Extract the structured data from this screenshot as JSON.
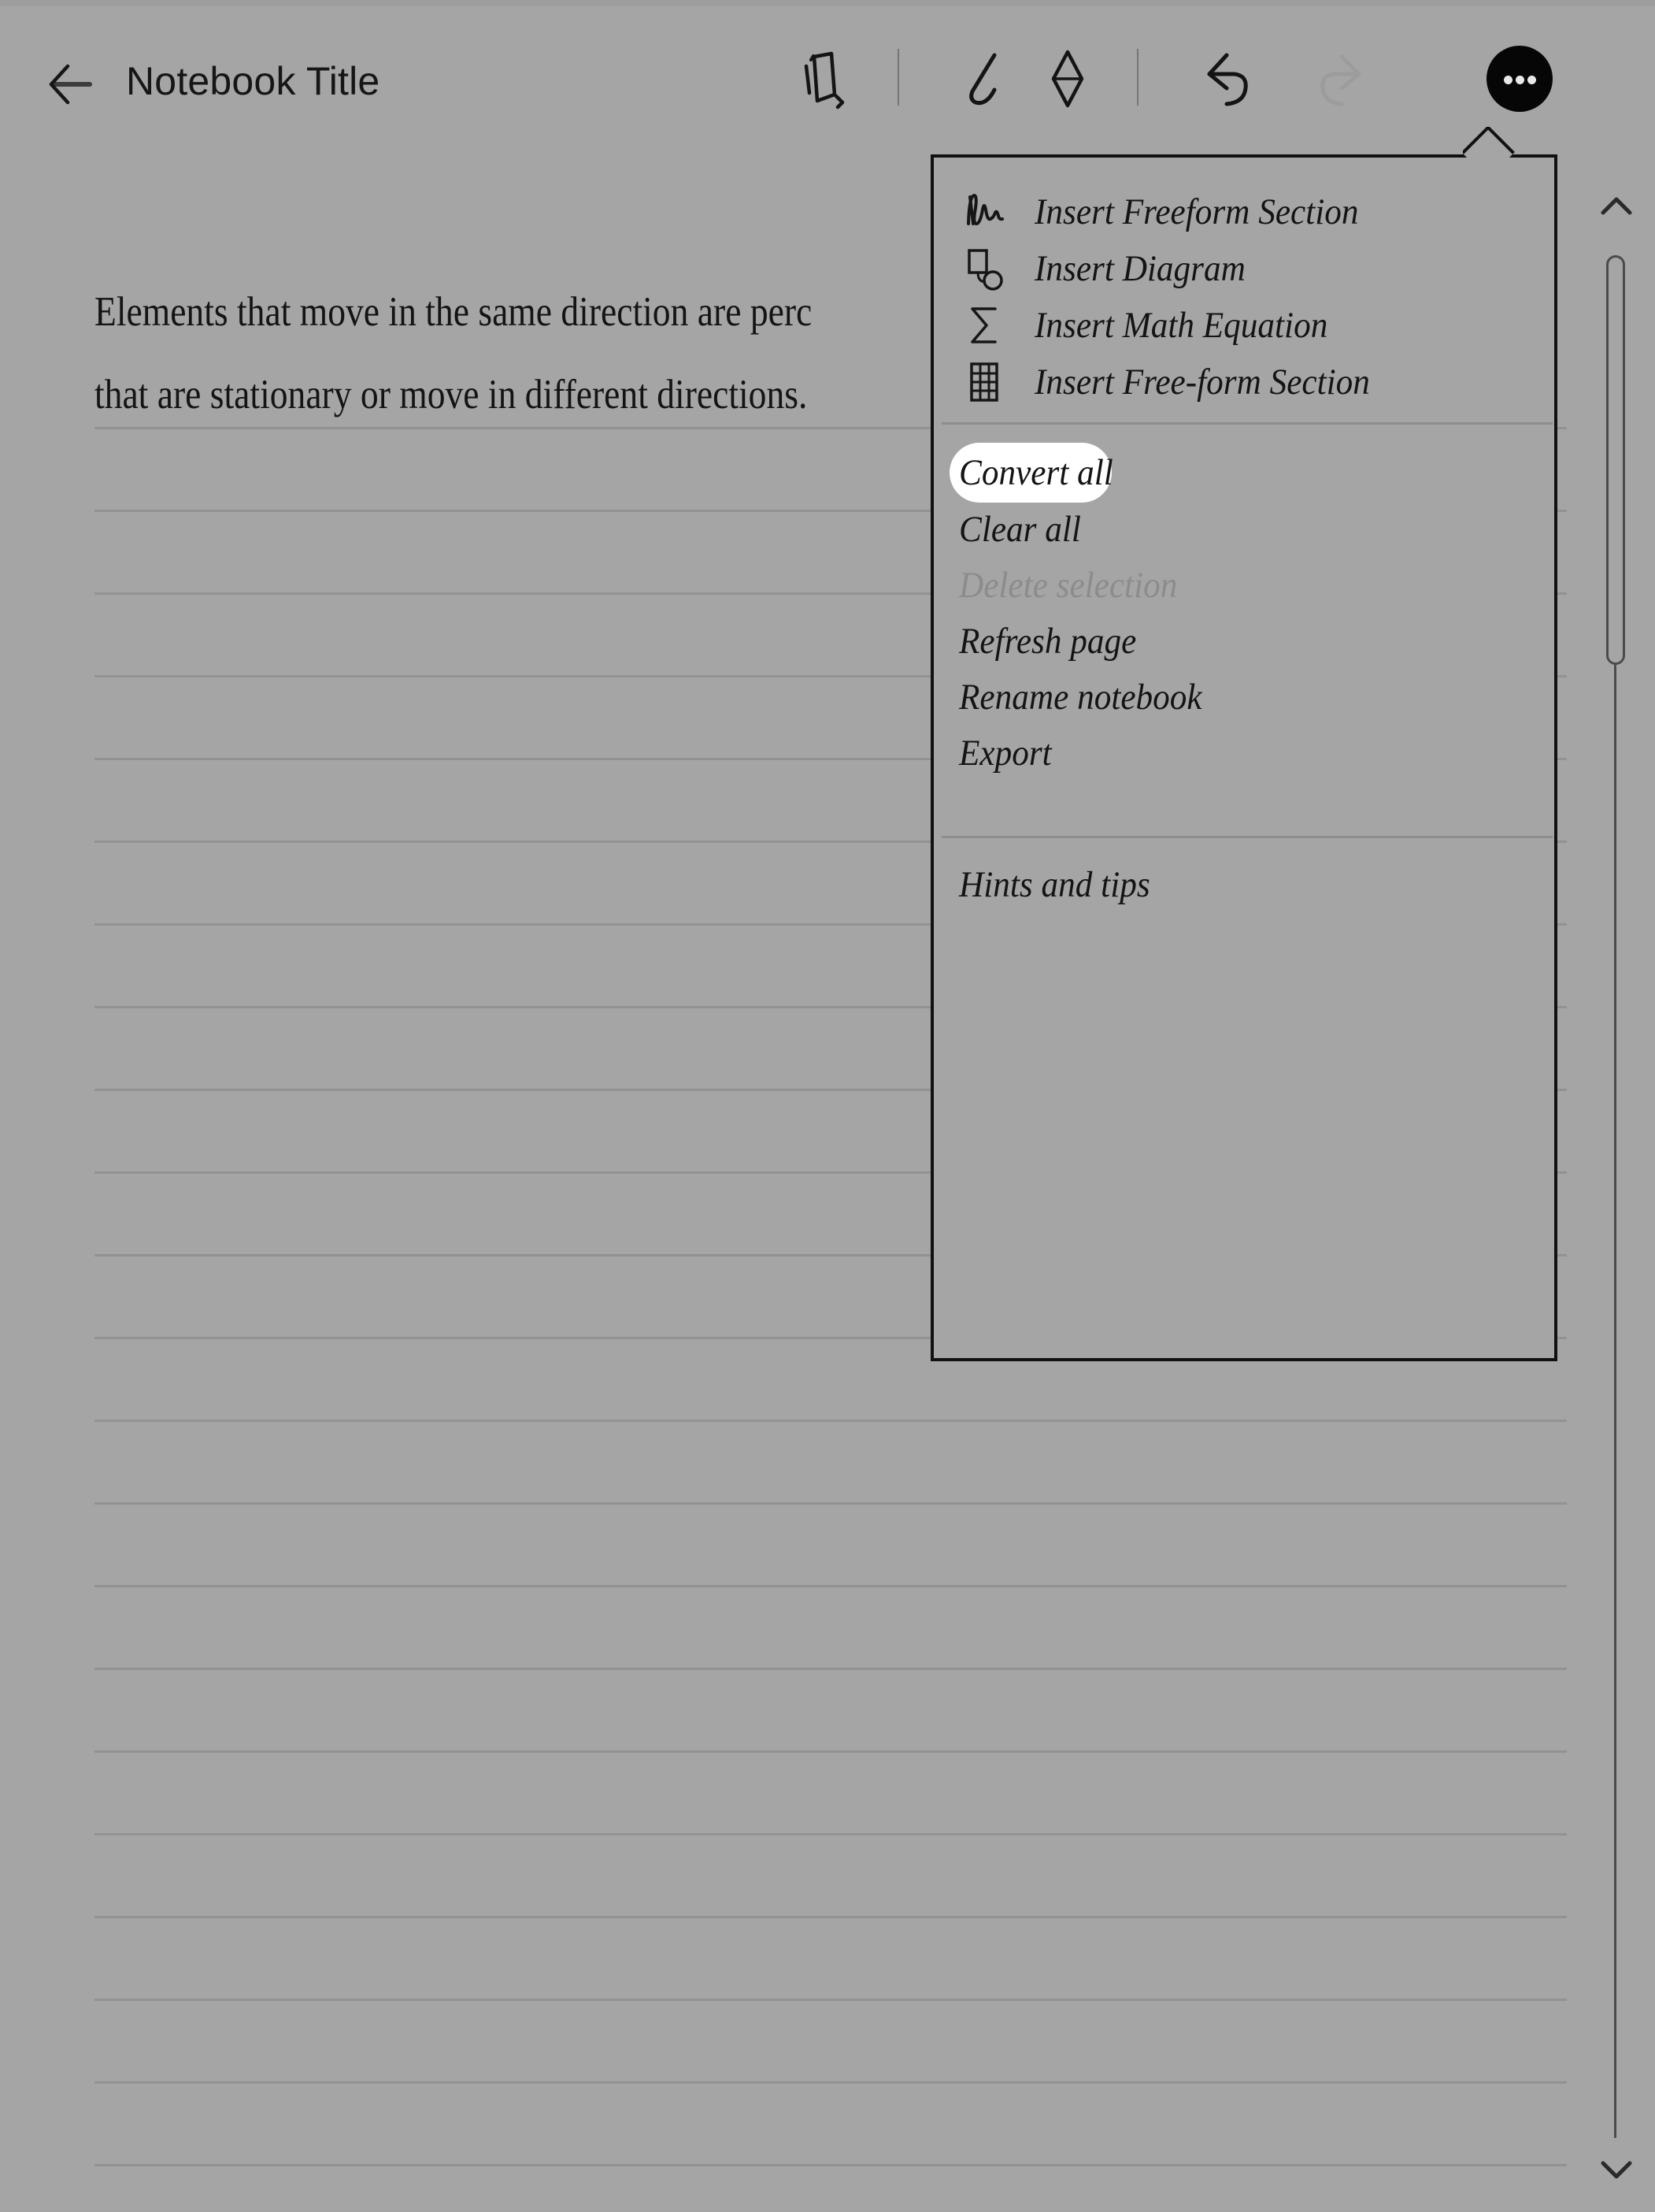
{
  "app": {
    "background_color": "#a5a5a5",
    "accent_color": "#060606"
  },
  "topbar": {
    "back_icon": "back-arrow-icon",
    "title": "Notebook Title",
    "tools": [
      {
        "name": "layers-icon",
        "label": "Layers"
      },
      {
        "name": "pen-icon",
        "label": "Pen"
      },
      {
        "name": "eraser-icon",
        "label": "Eraser"
      },
      {
        "name": "undo-icon",
        "label": "Undo"
      },
      {
        "name": "redo-icon",
        "label": "Redo"
      }
    ],
    "more_button": {
      "name": "more-options-icon",
      "label": "More options",
      "state": "active"
    }
  },
  "note": {
    "lines": [
      "Elements that move in the same direction are perc",
      "that are stationary or move in different directions."
    ],
    "ruled_line_color": "#929292"
  },
  "scrollbar": {
    "up_icon": "chevron-up-icon",
    "down_icon": "chevron-down-icon",
    "thumb_color": "#4b4b4b"
  },
  "menu": {
    "groups": [
      {
        "items": [
          {
            "label": "Insert Freeform Section",
            "icon": "handwriting-squiggle-icon",
            "state": "enabled",
            "highlighted": false
          },
          {
            "label": "Insert Diagram",
            "icon": "diagram-shapes-icon",
            "state": "enabled",
            "highlighted": false
          },
          {
            "label": "Insert Math Equation",
            "icon": "sigma-icon",
            "state": "enabled",
            "highlighted": false
          },
          {
            "label": "Insert Free-form Section",
            "icon": "table-grid-icon",
            "state": "enabled",
            "highlighted": false
          }
        ]
      },
      {
        "items": [
          {
            "label": "Convert all",
            "icon": null,
            "state": "enabled",
            "highlighted": true
          },
          {
            "label": "Clear all",
            "icon": null,
            "state": "enabled",
            "highlighted": false
          },
          {
            "label": "Delete selection",
            "icon": null,
            "state": "disabled",
            "highlighted": false
          },
          {
            "label": "Refresh page",
            "icon": null,
            "state": "enabled",
            "highlighted": false
          },
          {
            "label": "Rename notebook",
            "icon": null,
            "state": "enabled",
            "highlighted": false
          },
          {
            "label": "Export",
            "icon": null,
            "state": "enabled",
            "highlighted": false
          }
        ]
      },
      {
        "items": [
          {
            "label": "Hints and tips",
            "icon": null,
            "state": "enabled",
            "highlighted": false
          }
        ]
      }
    ]
  }
}
